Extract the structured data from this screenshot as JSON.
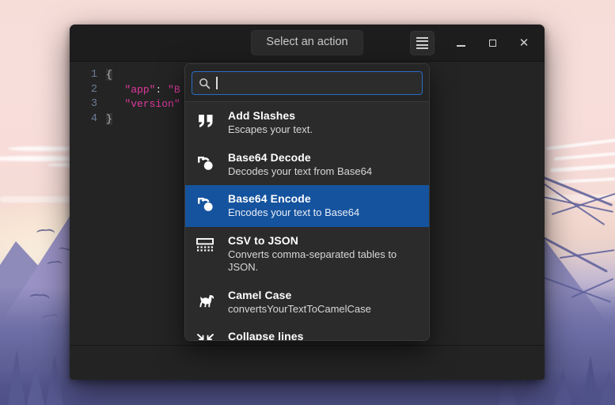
{
  "window": {
    "title_button": "Select an action",
    "controls": {
      "menu": "menu-icon",
      "minimize": "minimize-icon",
      "maximize": "maximize-icon",
      "close": "close-icon"
    }
  },
  "editor": {
    "line_numbers": [
      "1",
      "2",
      "3",
      "4"
    ],
    "lines": [
      {
        "brace": "{",
        "str1": "",
        "punc": "",
        "str2": ""
      },
      {
        "brace": "",
        "str1": "\"app\"",
        "punc": ": ",
        "str2": "\"B"
      },
      {
        "brace": "",
        "str1": "\"version\"",
        "punc": "",
        "str2": ""
      },
      {
        "brace": "}",
        "str1": "",
        "punc": "",
        "str2": ""
      }
    ]
  },
  "picker": {
    "search": {
      "value": "",
      "placeholder": ""
    },
    "items": [
      {
        "icon": "quotes-icon",
        "title": "Add Slashes",
        "description": "Escapes your text.",
        "selected": false
      },
      {
        "icon": "base64-decode-icon",
        "title": "Base64 Decode",
        "description": "Decodes your text from Base64",
        "selected": false
      },
      {
        "icon": "base64-encode-icon",
        "title": "Base64 Encode",
        "description": "Encodes your text to Base64",
        "selected": true
      },
      {
        "icon": "table-icon",
        "title": "CSV to JSON",
        "description": "Converts comma-separated tables to JSON.",
        "selected": false
      },
      {
        "icon": "camel-icon",
        "title": "Camel Case",
        "description": "convertsYourTextToCamelCase",
        "selected": false
      },
      {
        "icon": "collapse-arrows-icon",
        "title": "Collapse lines",
        "description": "",
        "selected": false
      }
    ]
  },
  "colors": {
    "selection_blue": "#15539e",
    "focus_border": "#2b6cc4",
    "window_bg": "#1f1f1f",
    "editor_bg": "#242424",
    "string_magenta": "#e0389f",
    "line_number": "#6c7a96"
  }
}
